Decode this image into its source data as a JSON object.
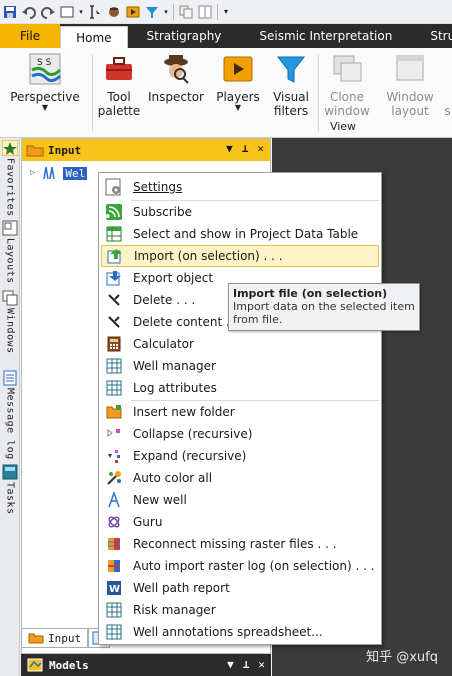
{
  "quick_access": {
    "icons": [
      "save-icon",
      "undo-icon",
      "redo-icon",
      "window-icon",
      "cursor-icon",
      "inspector-icon",
      "player-icon",
      "filter-icon",
      "copy-icon",
      "layout-icon",
      "customize-icon"
    ]
  },
  "tabs": [
    {
      "label": "File"
    },
    {
      "label": "Home"
    },
    {
      "label": "Stratigraphy"
    },
    {
      "label": "Seismic Interpretation"
    },
    {
      "label": "Structu"
    }
  ],
  "ribbon": {
    "perspective": "Perspective",
    "tool_palette_1": "Tool",
    "tool_palette_2": "palette",
    "inspector": "Inspector",
    "players": "Players",
    "visual_filters_1": "Visual",
    "visual_filters_2": "filters",
    "clone_window_1": "Clone",
    "clone_window_2": "window",
    "window_layout_1": "Window",
    "window_layout_2": "layout",
    "group_view": "View",
    "overflow": "s"
  },
  "side_tabs": [
    "Favorites",
    "Layouts",
    "Windows",
    "Message log",
    "Tasks"
  ],
  "input_panel": {
    "title": "Input",
    "tree_item": "Wel",
    "bottom_tab_label": "Input"
  },
  "models_panel": {
    "title": "Models"
  },
  "context_menu": {
    "items": [
      {
        "label": "Settings",
        "icon": "settings-icon"
      },
      {
        "label": "Subscribe",
        "icon": "subscribe-icon"
      },
      {
        "label": "Select and show in Project Data Table",
        "icon": "table-icon"
      },
      {
        "label": "Import (on selection) . . .",
        "icon": "import-icon",
        "highlighted": true
      },
      {
        "label": "Export object",
        "icon": "export-icon"
      },
      {
        "label": "Delete . . .",
        "icon": "delete-icon"
      },
      {
        "label": "Delete content . . .",
        "icon": "delete-content-icon"
      },
      {
        "label": "Calculator",
        "icon": "calculator-icon"
      },
      {
        "label": "Well manager",
        "icon": "spreadsheet-icon"
      },
      {
        "label": "Log attributes",
        "icon": "spreadsheet-icon"
      },
      {
        "label": "Insert new folder",
        "icon": "folder-icon"
      },
      {
        "label": "Collapse (recursive)",
        "icon": "collapse-icon"
      },
      {
        "label": "Expand (recursive)",
        "icon": "expand-icon"
      },
      {
        "label": "Auto color all",
        "icon": "color-icon"
      },
      {
        "label": "New well",
        "icon": "well-icon"
      },
      {
        "label": "Guru",
        "icon": "guru-icon"
      },
      {
        "label": "Reconnect missing raster files . . .",
        "icon": "raster-icon"
      },
      {
        "label": "Auto import raster log (on selection) . . .",
        "icon": "raster-import-icon"
      },
      {
        "label": "Well path report",
        "icon": "word-icon"
      },
      {
        "label": "Risk manager",
        "icon": "spreadsheet-icon"
      },
      {
        "label": "Well annotations spreadsheet...",
        "icon": "spreadsheet-icon"
      }
    ]
  },
  "tooltip": {
    "title": "Import file (on selection)",
    "line1": "Import data on the selected item",
    "line2": "from file."
  },
  "watermark": "知乎 @xufq",
  "colors": {
    "file_tab": "#f5b400",
    "panel_title": "#f7c21a",
    "workspace": "#3b3b3b",
    "selection": "#2a63c4",
    "menu_highlight": "#fdf3c4"
  }
}
